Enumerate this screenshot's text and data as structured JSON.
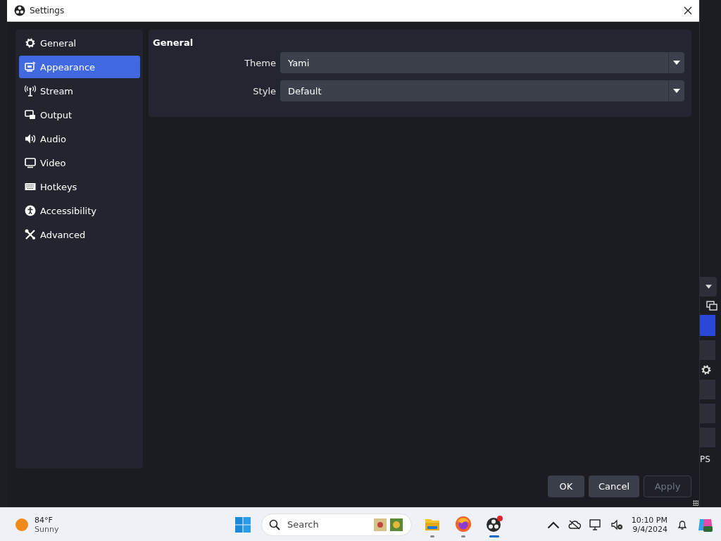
{
  "window": {
    "title": "Settings"
  },
  "sidebar": {
    "items": [
      {
        "label": "General",
        "kind": "gear",
        "selected": false
      },
      {
        "label": "Appearance",
        "kind": "appearance",
        "selected": true
      },
      {
        "label": "Stream",
        "kind": "antenna",
        "selected": false
      },
      {
        "label": "Output",
        "kind": "output",
        "selected": false
      },
      {
        "label": "Audio",
        "kind": "speaker",
        "selected": false
      },
      {
        "label": "Video",
        "kind": "monitor",
        "selected": false
      },
      {
        "label": "Hotkeys",
        "kind": "keyboard",
        "selected": false
      },
      {
        "label": "Accessibility",
        "kind": "accessibility",
        "selected": false
      },
      {
        "label": "Advanced",
        "kind": "tools",
        "selected": false
      }
    ]
  },
  "section": {
    "title": "General",
    "fields": [
      {
        "label": "Theme",
        "value": "Yami"
      },
      {
        "label": "Style",
        "value": "Default"
      }
    ]
  },
  "buttons": [
    {
      "label": "OK",
      "disabled": false
    },
    {
      "label": "Cancel",
      "disabled": false
    },
    {
      "label": "Apply",
      "disabled": true
    }
  ],
  "background_window": {
    "text": "PS"
  },
  "taskbar": {
    "weather": {
      "temperature": "84°F",
      "condition": "Sunny"
    },
    "search": {
      "placeholder": "Search"
    },
    "clock": {
      "time": "10:10 PM",
      "date": "9/4/2024"
    }
  }
}
